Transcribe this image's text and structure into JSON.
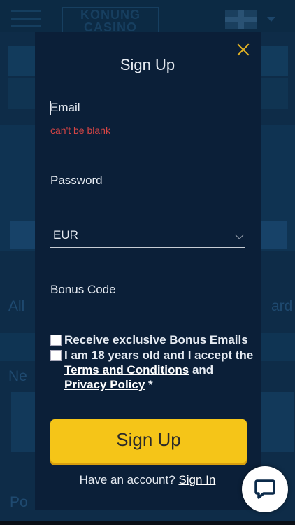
{
  "background": {
    "logo_text": "KONUNG\nCASINO",
    "category_left": "All",
    "category_right": "ard",
    "section_new": "Ne",
    "section_popular": "Po"
  },
  "modal": {
    "title": "Sign Up",
    "close_icon": "close-icon",
    "email": {
      "placeholder": "Email",
      "error": "can't be blank"
    },
    "password": {
      "placeholder": "Password"
    },
    "currency": {
      "selected": "EUR"
    },
    "bonus_code": {
      "placeholder": "Bonus Code"
    },
    "checkbox_bonus_emails": {
      "label": "Receive exclusive Bonus Emails"
    },
    "checkbox_age": {
      "label": "I am 18 years old and I accept the",
      "terms_link": "Terms and Conditions",
      "and_text": "and",
      "privacy_link": "Privacy Policy",
      "required_mark": "*"
    },
    "signup_button": "Sign Up",
    "account_prompt": "Have an account?",
    "signin_link": "Sign In"
  },
  "colors": {
    "accent": "#f5c518",
    "error": "#d64545",
    "modal_bg": "#0b1f38",
    "close": "#e4b423"
  },
  "chat_icon": "chat-bubble-icon"
}
